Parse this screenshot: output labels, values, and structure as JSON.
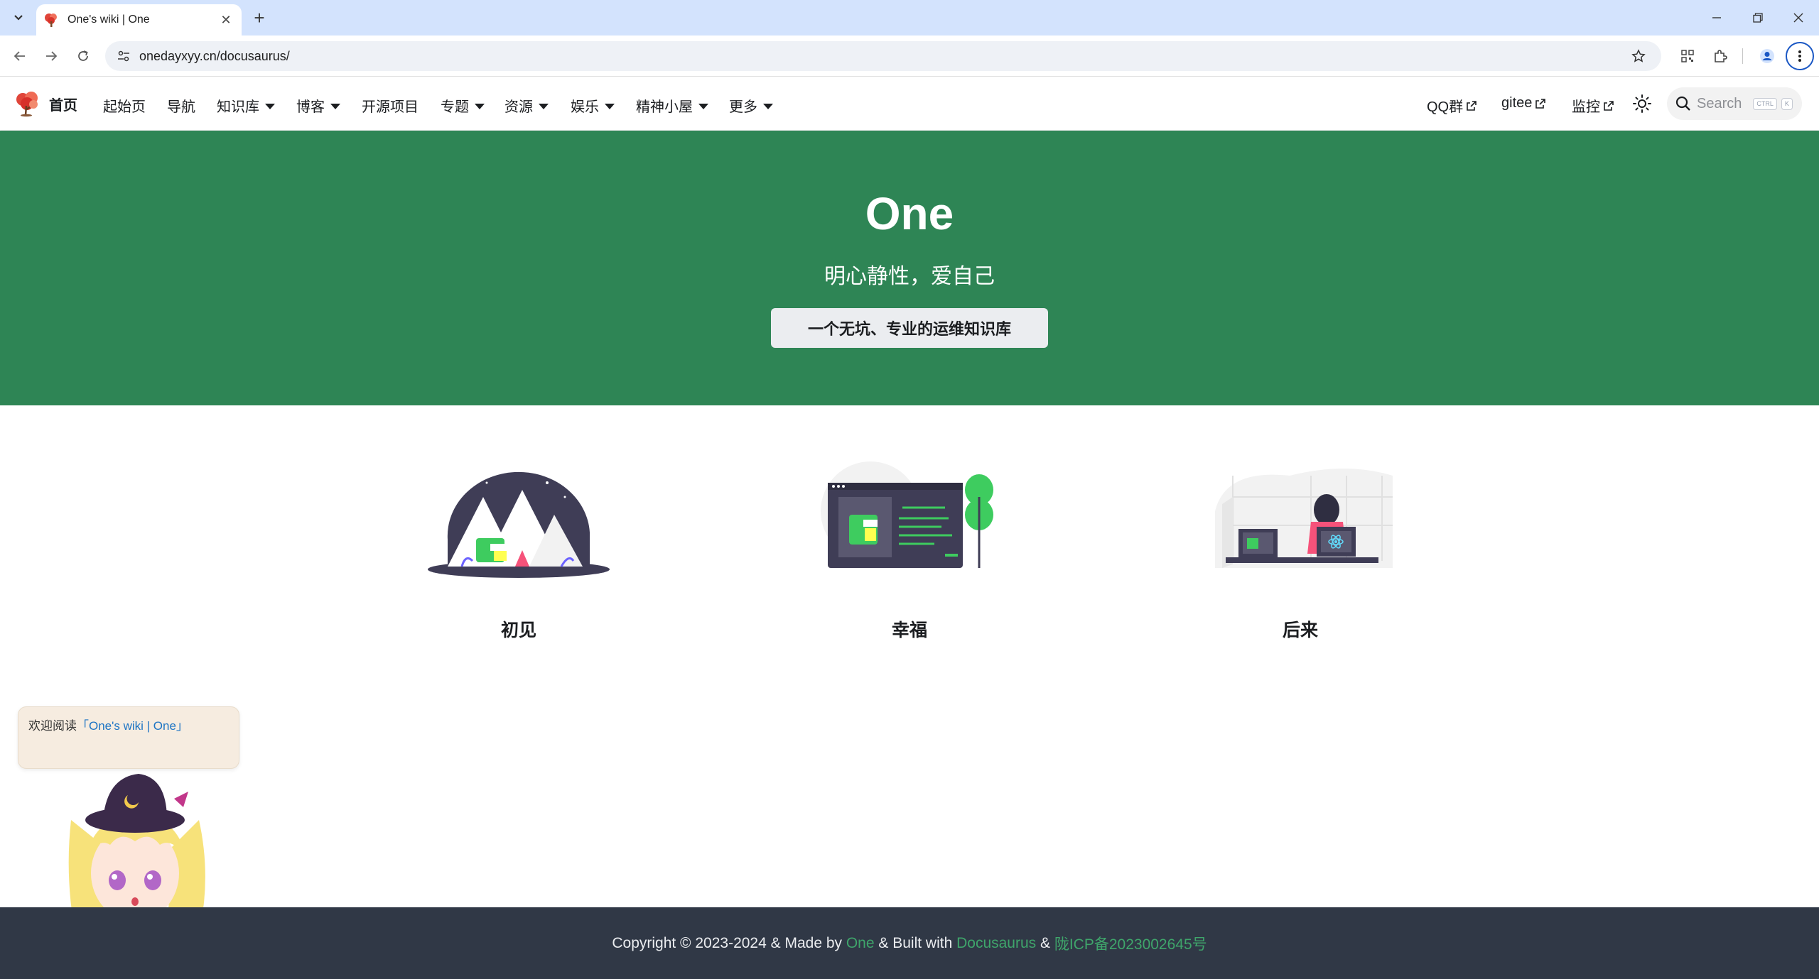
{
  "browser": {
    "tab_title": "One's wiki | One",
    "url": "onedayxyy.cn/docusaurus/"
  },
  "site": {
    "brand": "首页",
    "nav_left": [
      {
        "label": "起始页"
      },
      {
        "label": "导航"
      },
      {
        "label": "知识库"
      },
      {
        "label": "博客"
      },
      {
        "label": "开源项目"
      },
      {
        "label": "专题"
      },
      {
        "label": "资源"
      },
      {
        "label": "娱乐"
      },
      {
        "label": "精神小屋"
      },
      {
        "label": "更多"
      }
    ],
    "nav_right": [
      {
        "label": "QQ群"
      },
      {
        "label": "gitee"
      },
      {
        "label": "监控"
      }
    ],
    "search_placeholder": "Search",
    "kbd_ctrl": "CTRL",
    "kbd_k": "K"
  },
  "hero": {
    "title": "One",
    "tagline": "明心静性，爱自己",
    "cta": "一个无坑、专业的运维知识库"
  },
  "features": [
    {
      "title": "初见"
    },
    {
      "title": "幸福"
    },
    {
      "title": "后来"
    }
  ],
  "bubble": {
    "prefix": "欢迎阅读",
    "link": "「One's wiki | One」"
  },
  "footer": {
    "part1": "Copyright © 2023-2024 & Made by ",
    "link1": "One",
    "part2": " & Built with ",
    "link2": "Docusaurus",
    "part3": " & ",
    "link3": "陇ICP备2023002645号"
  },
  "colors": {
    "hero_bg": "#2e8555",
    "footer_bg": "#303846",
    "tabstrip_bg": "#d3e3fd",
    "bubble_bg": "#f6ece0",
    "link_green": "#3fa56b"
  }
}
